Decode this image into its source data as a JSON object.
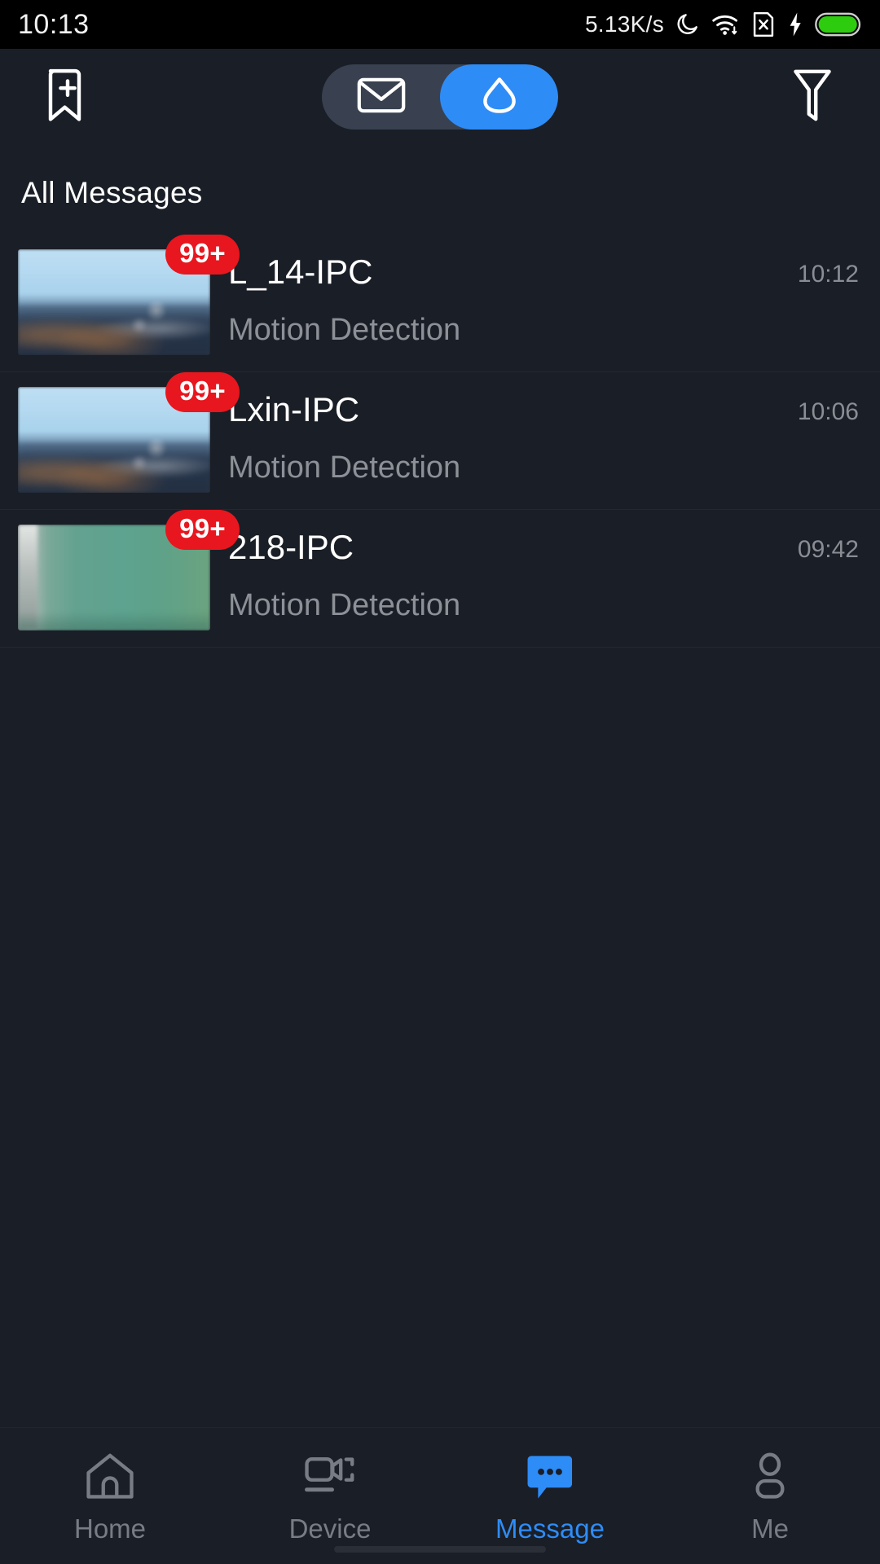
{
  "statusbar": {
    "time": "10:13",
    "network_speed": "5.13K/s",
    "icons": [
      "do-not-disturb-moon-icon",
      "wifi-icon",
      "sim-card-disabled-icon",
      "charging-bolt-icon",
      "battery-icon"
    ],
    "battery_color": "#2ecc0f"
  },
  "header": {
    "bookmark_add_label": "bookmark-add",
    "filter_label": "filter",
    "segments": [
      {
        "id": "mail",
        "label": "Messages",
        "active": false
      },
      {
        "id": "cloud",
        "label": "Cloud",
        "active": true
      }
    ],
    "active_color": "#2e8cf7"
  },
  "section": {
    "title": "All Messages"
  },
  "messages": [
    {
      "title": "L_14-IPC",
      "subtitle": "Motion Detection",
      "time": "10:12",
      "badge": "99+",
      "thumb": "city-skyline"
    },
    {
      "title": "Lxin-IPC",
      "subtitle": "Motion Detection",
      "time": "10:06",
      "badge": "99+",
      "thumb": "city-skyline"
    },
    {
      "title": "218-IPC",
      "subtitle": "Motion Detection",
      "time": "09:42",
      "badge": "99+",
      "thumb": "green-scene"
    }
  ],
  "bottomnav": {
    "items": [
      {
        "label": "Home",
        "icon": "home-icon",
        "active": false
      },
      {
        "label": "Device",
        "icon": "camera-device-icon",
        "active": false
      },
      {
        "label": "Message",
        "icon": "chat-bubble-icon",
        "active": true
      },
      {
        "label": "Me",
        "icon": "person-icon",
        "active": false
      }
    ],
    "active_color": "#2e8cf7",
    "inactive_color": "#787c84"
  }
}
